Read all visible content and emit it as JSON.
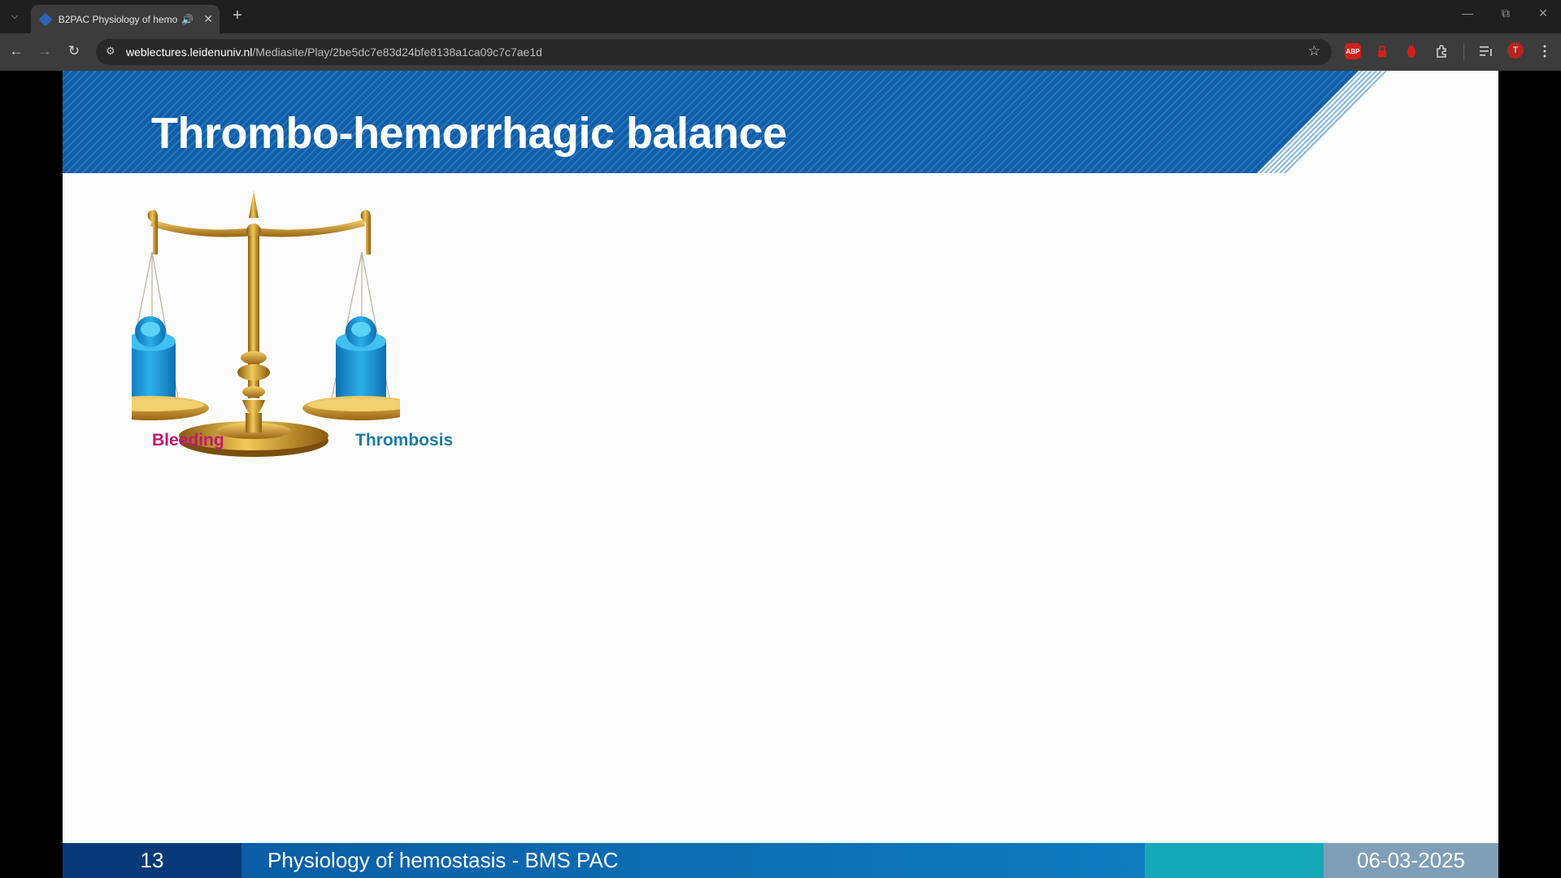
{
  "browser": {
    "tab": {
      "title": "B2PAC Physiology of hemo"
    },
    "url": {
      "host": "weblectures.leidenuniv.nl",
      "path": "/Mediasite/Play/2be5dc7e83d24bfe8138a1ca09c7c7ae1d"
    },
    "extensions": [
      {
        "name": "adblock-plus-icon",
        "label": "ABP",
        "color": "#d0211d"
      },
      {
        "name": "lock-extension-icon",
        "label": "",
        "color": "#d0211d"
      },
      {
        "name": "hand-extension-icon",
        "label": "",
        "color": "#d0211d"
      }
    ],
    "profile_initial": "T"
  },
  "slide": {
    "title": "Thrombo-hemorrhagic balance",
    "scale": {
      "left_label": "Bleeding",
      "right_label": "Thrombosis"
    },
    "colors": {
      "header_blue": "#0f5ea8",
      "bleeding": "#c0186e",
      "thrombosis": "#1e7ba6",
      "weight_blue": "#1891d4",
      "gold": "#c9961c"
    },
    "footer": {
      "page_number": "13",
      "course_title": "Physiology of hemostasis - BMS PAC",
      "date": "06-03-2025"
    }
  }
}
